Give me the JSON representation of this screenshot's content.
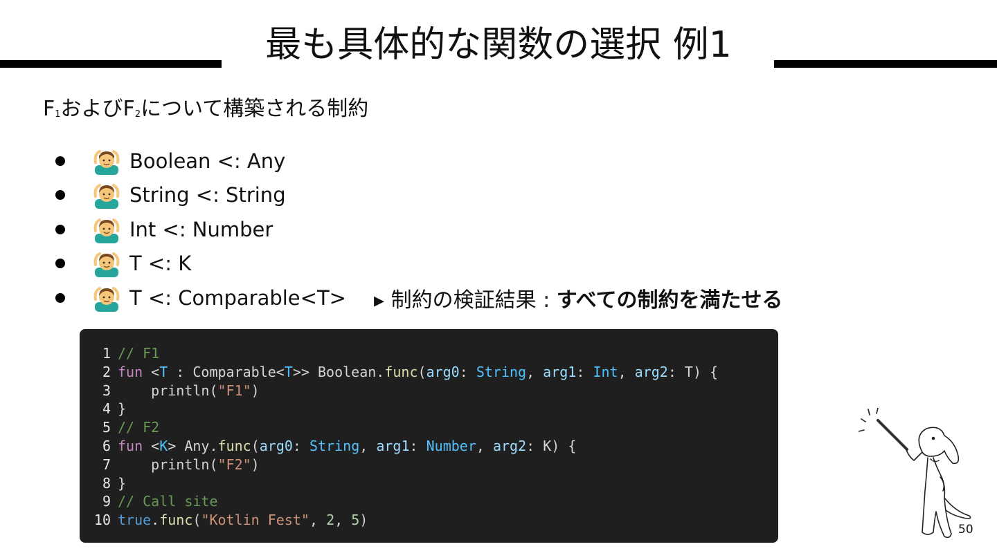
{
  "slide": {
    "title": "最も具体的な関数の選択 例1",
    "subtitle_prefix": "F",
    "subtitle_sub1": "1",
    "subtitle_mid": "およびF",
    "subtitle_sub2": "2",
    "subtitle_suffix": "について構築される制約",
    "page_number": "50"
  },
  "constraints": [
    {
      "icon": "ok-gesture-person-icon",
      "text": "Boolean <: Any"
    },
    {
      "icon": "ok-gesture-person-icon",
      "text": "String <: String"
    },
    {
      "icon": "ok-gesture-person-icon",
      "text": "Int <: Number"
    },
    {
      "icon": "ok-gesture-person-icon",
      "text": "T <: K"
    },
    {
      "icon": "ok-gesture-person-icon",
      "text": "T <: Comparable<T>"
    }
  ],
  "result": {
    "prefix": "▸ 制約の検証結果 : ",
    "emphasis": "すべての制約を満たせる"
  },
  "code": {
    "line_numbers": [
      "1",
      "2",
      "3",
      "4",
      "5",
      "6",
      "7",
      "8",
      "9",
      "10"
    ],
    "lines": [
      "// F1",
      "fun <T : Comparable<T>> Boolean.func(arg0: String, arg1: Int, arg2: T) {",
      "    println(\"F1\")",
      "}",
      "// F2",
      "fun <K> Any.func(arg0: String, arg1: Number, arg2: K) {",
      "    println(\"F2\")",
      "}",
      "// Call site",
      "true.func(\"Kotlin Fest\", 2, 5)"
    ]
  },
  "colors": {
    "code_background": "#1f1f1f",
    "comment": "#6a9955",
    "keyword": "#c586c0",
    "type": "#4fc1ff",
    "function": "#dcdcaa",
    "string": "#ce9178",
    "number": "#b5cea8"
  }
}
